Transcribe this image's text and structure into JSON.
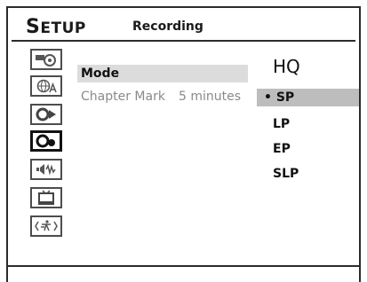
{
  "header": {
    "title_initial": "S",
    "title_rest": "ETUP",
    "subtitle": "Recording"
  },
  "sidebar": {
    "items": [
      {
        "icon": "disc-settings-icon",
        "selected": false
      },
      {
        "icon": "language-icon",
        "selected": false
      },
      {
        "icon": "playback-icon",
        "selected": false
      },
      {
        "icon": "recording-icon",
        "selected": true
      },
      {
        "icon": "audio-icon",
        "selected": false
      },
      {
        "icon": "tv-display-icon",
        "selected": false
      },
      {
        "icon": "exit-icon",
        "selected": false
      }
    ]
  },
  "menu": {
    "mode": {
      "label": "Mode",
      "value": "HQ"
    },
    "chapter_mark": {
      "label": "Chapter Mark",
      "value": "5 minutes"
    }
  },
  "options": {
    "bullet": "•",
    "items": [
      "SP",
      "LP",
      "EP",
      "SLP"
    ],
    "highlighted": "SP"
  }
}
